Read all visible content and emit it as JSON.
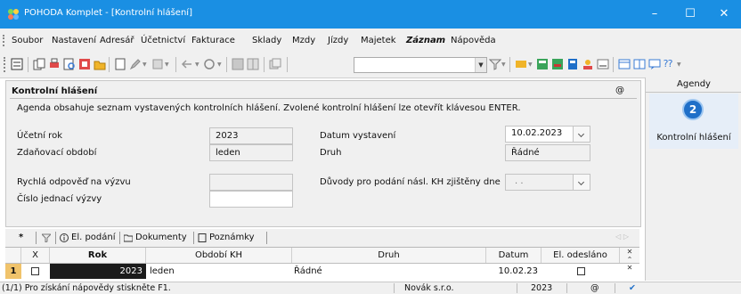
{
  "window": {
    "title": "POHODA Komplet - [Kontrolní hlášení]",
    "minimize_glyph": "–",
    "maximize_glyph": "☐",
    "close_glyph": "✕"
  },
  "menu": [
    "Soubor",
    "Nastavení",
    "Adresář",
    "Účetnictví",
    "Fakturace",
    "Sklady",
    "Mzdy",
    "Jízdy",
    "Majetek",
    "Záznam",
    "Nápověda"
  ],
  "toolbar": {
    "combo_value": "",
    "last_icon_glyph": "⁇"
  },
  "form": {
    "title": "Kontrolní hlášení",
    "at_glyph": "@",
    "description": "Agenda obsahuje seznam vystavených kontrolních hlášení. Zvolené kontrolní hlášení lze otevřít klávesou ENTER.",
    "ucetni_rok_label": "Účetní rok",
    "ucetni_rok_value": "2023",
    "zdanovaci_obdobi_label": "Zdaňovací období",
    "zdanovaci_obdobi_value": "leden",
    "datum_vystaveni_label": "Datum vystavení",
    "datum_vystaveni_value": "10.02.2023",
    "druh_label": "Druh",
    "druh_value": "Řádné",
    "rychla_odpoved_label": "Rychlá odpověď na výzvu",
    "rychla_odpoved_value": "",
    "cislo_jednaci_label": "Číslo jednací výzvy",
    "cislo_jednaci_value": "",
    "duvody_label": "Důvody pro podání násl. KH zjištěny dne",
    "duvody_value": ". ."
  },
  "agendy": {
    "header": "Agendy",
    "item_icon_glyph": "2",
    "item_label": "Kontrolní hlášení"
  },
  "tabs": {
    "star": "*",
    "items": [
      "El. podání",
      "Dokumenty",
      "Poznámky"
    ],
    "nav": "◁ ▷"
  },
  "grid": {
    "columns": [
      "X",
      "Rok",
      "Období KH",
      "Druh",
      "Datum",
      "El. odesláno"
    ],
    "rows": [
      {
        "num": "1",
        "rok": "2023",
        "obdobi": "leden",
        "druh": "Řádné",
        "datum": "10.02.23",
        "el_odeslano": false
      }
    ]
  },
  "status": {
    "help": "(1/1) Pro získání nápovědy stiskněte F1.",
    "company": "Novák s.r.o.",
    "year": "2023",
    "at_glyph": "@",
    "check_glyph": "✔"
  },
  "colors": {
    "titlebar": "#1a8fe3",
    "chrome": "#f0f0f0",
    "selection": "#1b1b1b"
  }
}
